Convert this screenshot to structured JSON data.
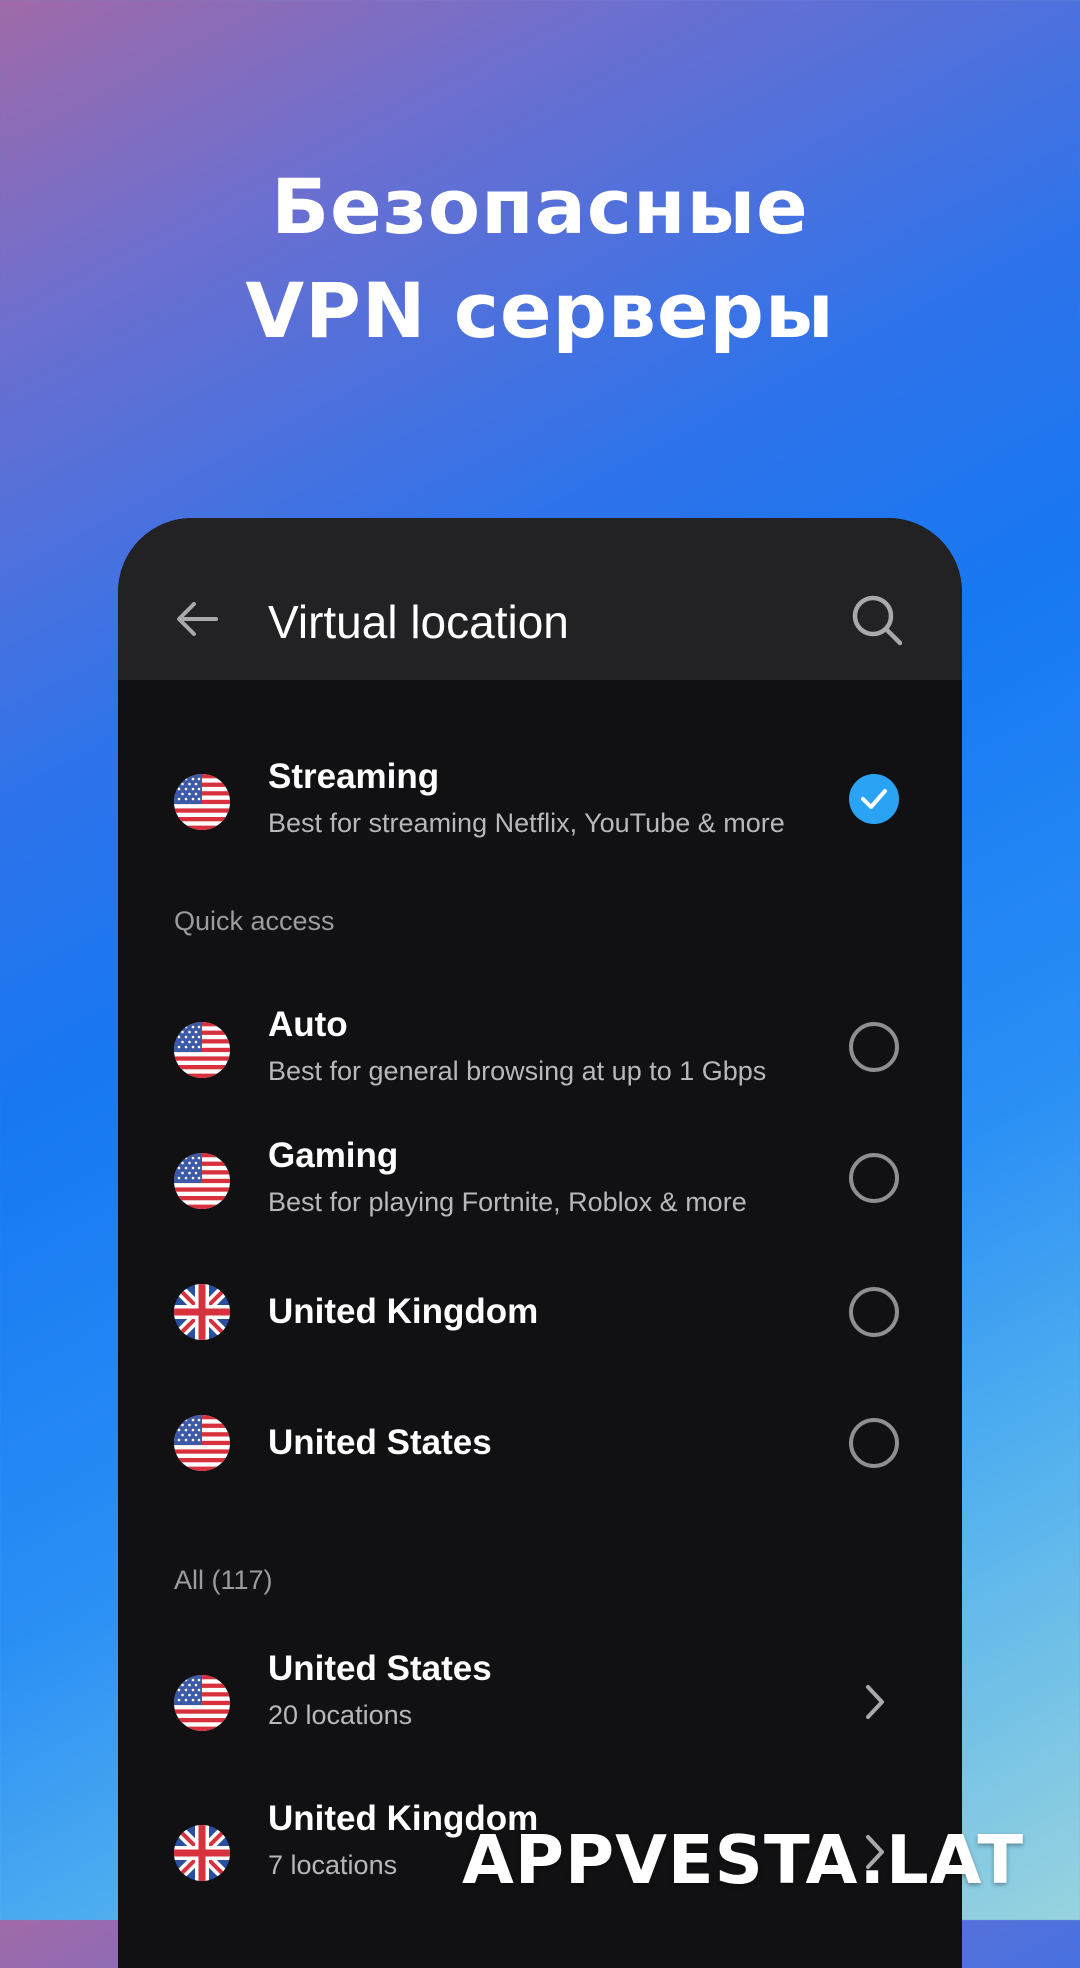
{
  "headline": {
    "line1": "Безопасные",
    "line2": "VPN серверы"
  },
  "toolbar": {
    "title": "Virtual location",
    "back_icon": "arrow-left-icon",
    "search_icon": "search-icon"
  },
  "featured": {
    "title": "Streaming",
    "subtitle": "Best for streaming Netflix, YouTube & more",
    "flag": "us-flag-icon",
    "selected": true
  },
  "quick_access": {
    "label": "Quick access",
    "items": [
      {
        "title": "Auto",
        "subtitle": "Best for general browsing at up to 1 Gbps",
        "flag": "us-flag-icon",
        "selected": false
      },
      {
        "title": "Gaming",
        "subtitle": "Best for playing Fortnite, Roblox & more",
        "flag": "us-flag-icon",
        "selected": false
      },
      {
        "title": "United Kingdom",
        "flag": "uk-flag-icon",
        "selected": false
      },
      {
        "title": "United States",
        "flag": "us-flag-icon",
        "selected": false
      }
    ]
  },
  "all": {
    "label": "All (117)",
    "items": [
      {
        "title": "United States",
        "subtitle": "20 locations",
        "flag": "us-flag-icon"
      },
      {
        "title": "United Kingdom",
        "subtitle": "7 locations",
        "flag": "uk-flag-icon"
      }
    ]
  },
  "watermark": "APPVESTA.LAT",
  "colors": {
    "accent": "#2aa3f5",
    "panel": "#111113",
    "toolbar": "#222224"
  }
}
